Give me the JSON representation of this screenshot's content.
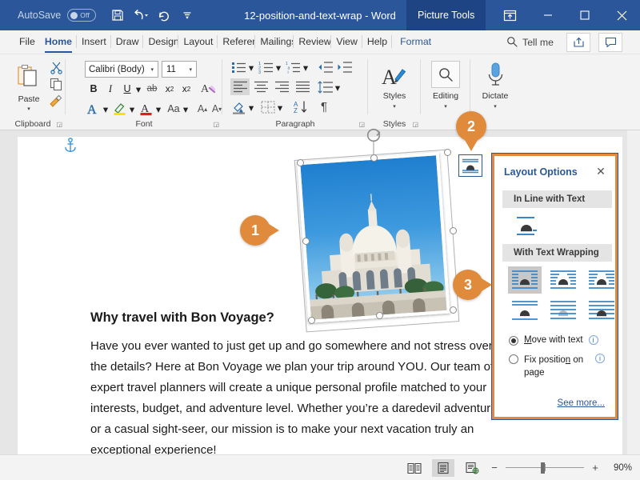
{
  "titlebar": {
    "autosave_label": "AutoSave",
    "autosave_state": "Off",
    "document_title": "12-position-and-text-wrap - Word",
    "contextual_tab": "Picture Tools",
    "save_icon": "save-icon",
    "undo_icon": "undo-icon",
    "redo_icon": "redo-icon",
    "more_icon": "qat-more-icon",
    "ribbon_display_icon": "ribbon-display-options-icon",
    "minimize_icon": "minimize-icon",
    "maximize_icon": "maximize-icon",
    "close_icon": "close-icon",
    "bg_color": "#2b579a",
    "ctx_color": "#1f4483"
  },
  "tabs": [
    {
      "label": "File"
    },
    {
      "label": "Home",
      "active": true
    },
    {
      "label": "Insert"
    },
    {
      "label": "Draw"
    },
    {
      "label": "Design"
    },
    {
      "label": "Layout"
    },
    {
      "label": "References"
    },
    {
      "label": "Mailings"
    },
    {
      "label": "Review"
    },
    {
      "label": "View"
    },
    {
      "label": "Help"
    },
    {
      "label": "Format",
      "contextual": true
    }
  ],
  "tellme": {
    "label": "Tell me",
    "search_icon": "search-icon",
    "share_icon": "share-icon",
    "comments_icon": "comments-icon"
  },
  "ribbon": {
    "groups": [
      {
        "name": "Clipboard",
        "label": "Clipboard"
      },
      {
        "name": "Font",
        "label": "Font"
      },
      {
        "name": "Paragraph",
        "label": "Paragraph"
      },
      {
        "name": "Styles",
        "label": "Styles"
      }
    ],
    "clipboard": {
      "paste_label": "Paste",
      "paste_icon": "paste-icon",
      "cut_icon": "cut-icon",
      "copy_icon": "copy-icon",
      "format_painter_icon": "format-painter-icon"
    },
    "font": {
      "font_name": "Calibri (Body)",
      "font_size": "11",
      "bold_label": "B",
      "italic_label": "I",
      "underline_label": "U",
      "strikethrough_label": "ab",
      "subscript_label": "x",
      "superscript_label": "x",
      "clear_formatting_icon": "clear-formatting-icon",
      "text_effects_icon": "text-effects-icon",
      "highlight_icon": "text-highlight-icon",
      "font_color_icon": "font-color-icon",
      "change_case_label": "Aa",
      "grow_font_label": "A",
      "shrink_font_label": "A"
    },
    "paragraph": {
      "bullets_icon": "bullets-icon",
      "numbering_icon": "numbering-icon",
      "multilevel_icon": "multilevel-list-icon",
      "decrease_indent_icon": "decrease-indent-icon",
      "increase_indent_icon": "increase-indent-icon",
      "align_left_icon": "align-left-icon",
      "align_center_icon": "align-center-icon",
      "align_right_icon": "align-right-icon",
      "justify_icon": "justify-icon",
      "line_spacing_icon": "line-spacing-icon",
      "shading_icon": "shading-icon",
      "borders_icon": "borders-icon",
      "sort_icon": "sort-icon",
      "show_marks_label": "¶"
    },
    "styles": {
      "label": "Styles",
      "icon": "styles-icon"
    },
    "editing": {
      "label": "Editing",
      "icon": "editing-search-icon"
    },
    "dictate": {
      "label": "Dictate",
      "icon": "microphone-icon"
    }
  },
  "document": {
    "anchor_icon": "object-anchor-icon",
    "heading": "Why travel with Bon Voyage?",
    "body": "Have you ever wanted to just get up and go somewhere and not stress over the details?  Here at Bon Voyage we plan your trip around YOU. Our team of expert travel planners will create a unique personal profile matched to your interests, budget, and adventure level. Whether you’re a daredevil adventurer or a casual sight-seer, our mission is to make your next vacation truly an exceptional experience!",
    "picture": {
      "name": "sacre-coeur-basilica-photo",
      "alt": "Sacre-Coeur Basilica photo",
      "rotation_handle_icon": "rotation-handle-icon",
      "selected": true,
      "handle_count": 8
    }
  },
  "layout_options": {
    "button_icon": "layout-options-button-icon",
    "title": "Layout Options",
    "close_label": "✕",
    "section_inline": "In Line with Text",
    "section_wrapping": "With Text Wrapping",
    "inline_option": {
      "name": "in-line-with-text",
      "selected": false
    },
    "wrap_options": [
      {
        "name": "square",
        "selected": true
      },
      {
        "name": "tight",
        "selected": false
      },
      {
        "name": "through",
        "selected": false
      },
      {
        "name": "top-and-bottom",
        "selected": false
      },
      {
        "name": "behind-text",
        "selected": false
      },
      {
        "name": "in-front-of-text",
        "selected": false
      }
    ],
    "move_with_text": {
      "label": "Move with text",
      "selected": true,
      "accel": "M"
    },
    "fix_position": {
      "label": "Fix position on page",
      "selected": false,
      "accel": "n"
    },
    "info_icon": "info-icon",
    "see_more": "See more...",
    "border_color": "#e18a3d"
  },
  "callouts": [
    {
      "number": "1",
      "points": "right"
    },
    {
      "number": "2",
      "points": "down"
    },
    {
      "number": "3",
      "points": "right"
    }
  ],
  "statusbar": {
    "read_mode_icon": "read-mode-icon",
    "print_layout_icon": "print-layout-icon",
    "web_layout_icon": "web-layout-icon",
    "zoom_out_label": "−",
    "zoom_in_label": "+",
    "zoom_value": "90%"
  }
}
